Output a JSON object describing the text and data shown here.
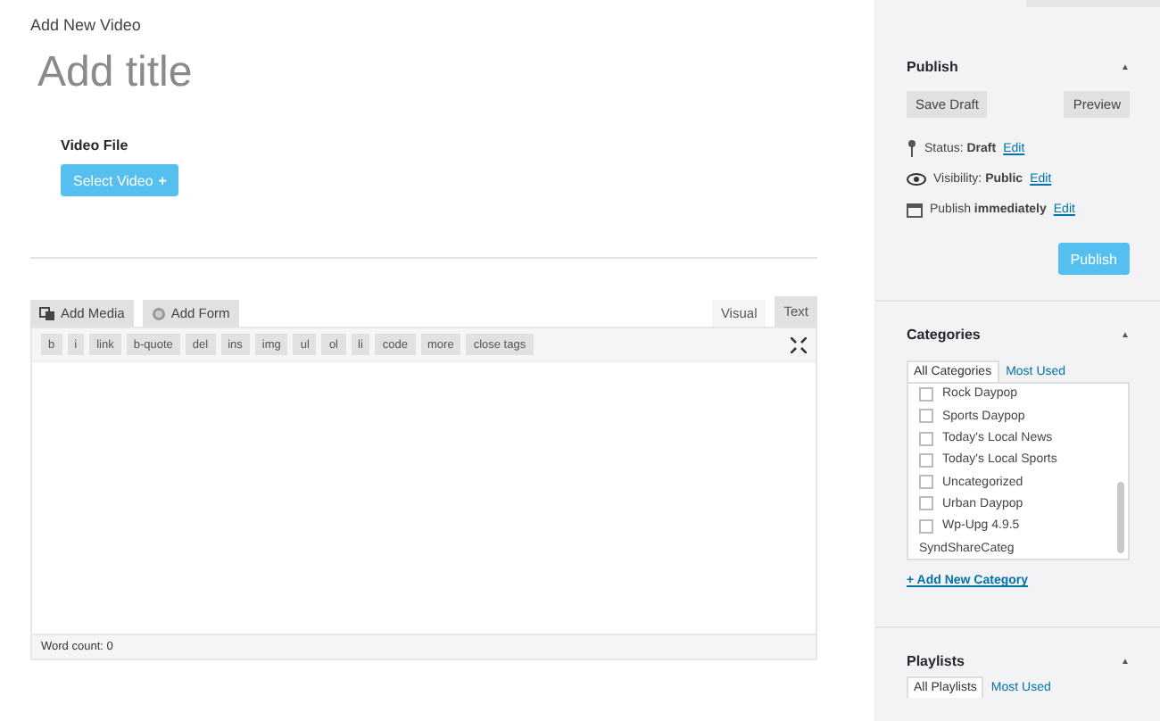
{
  "page_title": "Add New Video",
  "title_field": {
    "placeholder": "Add title"
  },
  "video_file": {
    "label": "Video File",
    "button": "Select Video",
    "button_icon": "+"
  },
  "media_buttons": [
    {
      "label": "Add Media",
      "kind": "media"
    },
    {
      "label": "Add Form",
      "kind": "form"
    }
  ],
  "editor_tabs": [
    {
      "label": "Visual",
      "selected": false
    },
    {
      "label": "Text",
      "selected": true
    }
  ],
  "quicktags": [
    "b",
    "i",
    "link",
    "b-quote",
    "del",
    "ins",
    "img",
    "ul",
    "ol",
    "li",
    "code",
    "more",
    "close tags"
  ],
  "word_count": "Word count: 0",
  "publish": {
    "title": "Publish",
    "toggle": "▲",
    "save_draft": "Save Draft",
    "preview": "Preview",
    "rows": [
      {
        "kind": "status",
        "label": "Status:",
        "value": "Draft",
        "link": "Edit"
      },
      {
        "kind": "visibility",
        "label": "Visibility:",
        "value": "Public",
        "link": "Edit"
      },
      {
        "kind": "schedule",
        "label": "Publish",
        "value": "immediately",
        "link": "Edit"
      }
    ],
    "button": "Publish"
  },
  "categories": {
    "title": "Categories",
    "toggle": "▲",
    "tabs": [
      {
        "label": "All Categories",
        "selected": true
      },
      {
        "label": "Most Used",
        "selected": false
      }
    ],
    "items": [
      {
        "kind": "checkbox",
        "label": "Rock Daypop",
        "checked": false
      },
      {
        "kind": "checkbox",
        "label": "Sports Daypop",
        "checked": false
      },
      {
        "kind": "checkbox",
        "label": "Today's Local News",
        "checked": false
      },
      {
        "kind": "checkbox",
        "label": "Today's Local Sports",
        "checked": false
      },
      {
        "kind": "checkbox",
        "label": "Uncategorized",
        "checked": false
      },
      {
        "kind": "checkbox",
        "label": "Urban Daypop",
        "checked": false
      },
      {
        "kind": "checkbox",
        "label": "Wp-Upg 4.9.5",
        "checked": false
      },
      {
        "kind": "plain",
        "label": "SyndShareCateg"
      }
    ],
    "add_link": "+ Add New Category"
  },
  "playlists": {
    "title": "Playlists",
    "toggle": "▲",
    "tabs": [
      {
        "label": "All Playlists",
        "selected": true
      },
      {
        "label": "Most Used",
        "selected": false
      }
    ]
  }
}
